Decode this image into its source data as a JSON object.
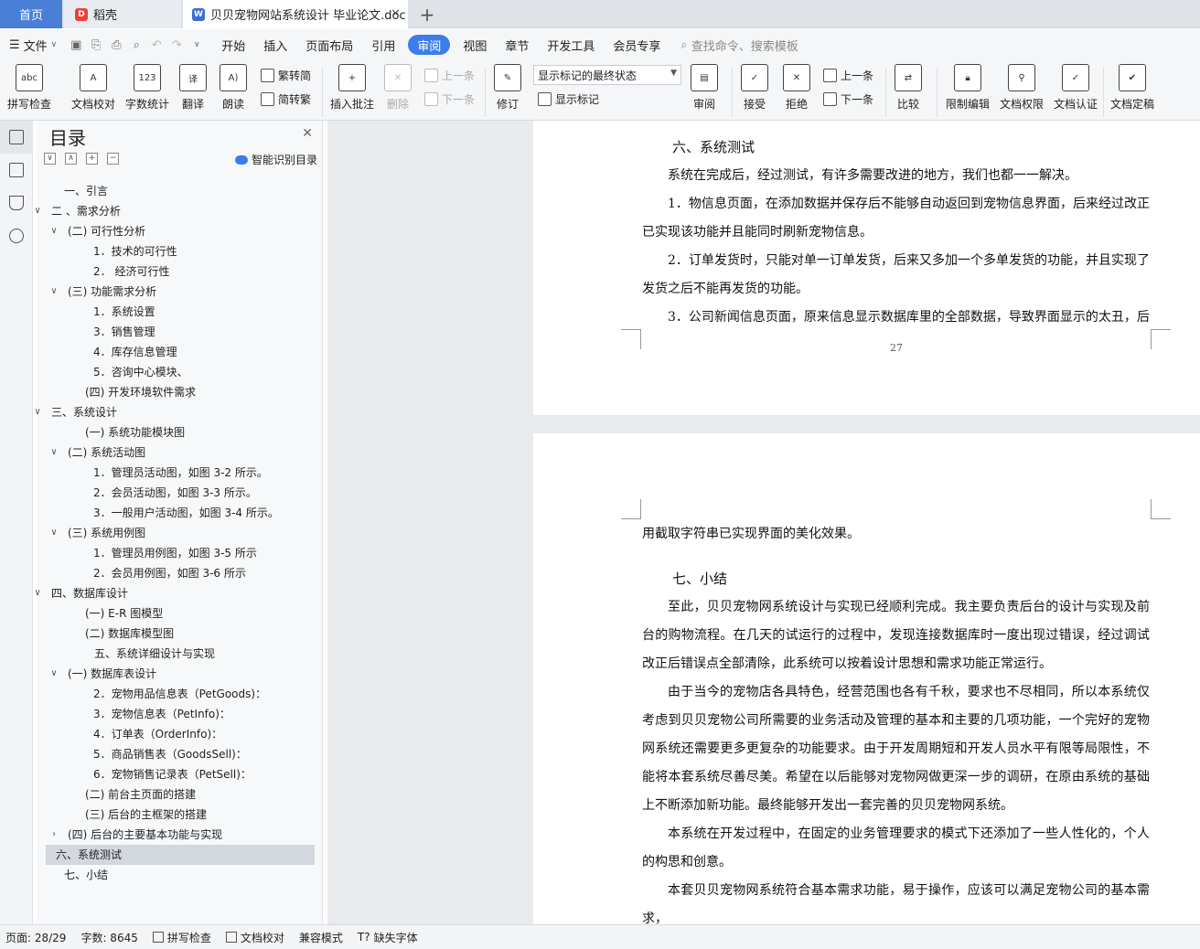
{
  "tabs": {
    "home": "首页",
    "daoke": "稻壳",
    "doc": "贝贝宠物网站系统设计 毕业论文.doc"
  },
  "menu": {
    "file": "文件",
    "items": [
      "开始",
      "插入",
      "页面布局",
      "引用",
      "审阅",
      "视图",
      "章节",
      "开发工具",
      "会员专享"
    ],
    "active": "审阅",
    "search": "查找命令、搜索模板"
  },
  "ribbon": {
    "spell": "拼写检查",
    "proof": "文档校对",
    "count": "字数统计",
    "translate": "翻译",
    "read": "朗读",
    "trad": "繁转简",
    "simp": "简转繁",
    "insert_comment": "插入批注",
    "delete": "删除",
    "prev": "上一条",
    "next": "下一条",
    "revise": "修订",
    "markup_select": "显示标记的最终状态",
    "show_markup": "显示标记",
    "review": "审阅",
    "accept": "接受",
    "reject": "拒绝",
    "prev2": "上一条",
    "next2": "下一条",
    "compare": "比较",
    "restrict": "限制编辑",
    "permission": "文档权限",
    "certify": "文档认证",
    "finalize": "文档定稿"
  },
  "toc": {
    "title": "目录",
    "smart": "智能识别目录",
    "items": [
      {
        "text": "一、引言"
      },
      {
        "text": "二 、需求分析"
      },
      {
        "text": "(二) 可行性分析"
      },
      {
        "text": "1．技术的可行性"
      },
      {
        "text": "2．  经济可行性"
      },
      {
        "text": "(三) 功能需求分析"
      },
      {
        "text": "1．系统设置"
      },
      {
        "text": "3．销售管理"
      },
      {
        "text": "4．库存信息管理"
      },
      {
        "text": "5．咨询中心模块、"
      },
      {
        "text": "(四) 开发环境软件需求"
      },
      {
        "text": "三、系统设计"
      },
      {
        "text": "(一) 系统功能模块图"
      },
      {
        "text": "(二) 系统活动图"
      },
      {
        "text": "1．管理员活动图，如图 3-2 所示。"
      },
      {
        "text": "2．会员活动图，如图 3-3 所示。"
      },
      {
        "text": "3．一般用户活动图，如图 3-4 所示。"
      },
      {
        "text": "(三) 系统用例图"
      },
      {
        "text": "1．管理员用例图，如图 3-5 所示"
      },
      {
        "text": "2．会员用例图，如图 3-6 所示"
      },
      {
        "text": "四、数据库设计"
      },
      {
        "text": "(一) E-R 图模型"
      },
      {
        "text": "(二) 数据库模型图"
      },
      {
        "text": "五、系统详细设计与实现"
      },
      {
        "text": "(一) 数据库表设计"
      },
      {
        "text": "2．宠物用品信息表（PetGoods)："
      },
      {
        "text": "3．宠物信息表（PetInfo)："
      },
      {
        "text": "4．订单表（OrderInfo)："
      },
      {
        "text": "5．商品销售表（GoodsSell)："
      },
      {
        "text": "6．宠物销售记录表（PetSell)："
      },
      {
        "text": "(二) 前台主页面的搭建"
      },
      {
        "text": "(三) 后台的主框架的搭建"
      },
      {
        "text": "(四) 后台的主要基本功能与实现"
      },
      {
        "text": "六、系统测试"
      },
      {
        "text": "七、小结"
      }
    ]
  },
  "page1": {
    "heading": "六、系统测试",
    "paras": [
      "系统在完成后，经过测试，有许多需要改进的地方，我们也都一一解决。",
      "1．物信息页面，在添加数据并保存后不能够自动返回到宠物信息界面，后来经过改正已实现该功能并且能同时刷新宠物信息。",
      "2．订单发货时，只能对单一订单发货，后来又多加一个多单发货的功能，并且实现了发货之后不能再发货的功能。",
      "3．公司新闻信息页面，原来信息显示数据库里的全部数据，导致界面显示的太丑，后"
    ],
    "page_number": "27"
  },
  "page2": {
    "continued": "用截取字符串已实现界面的美化效果。",
    "heading": "七、小结",
    "paras": [
      "至此，贝贝宠物网系统设计与实现已经顺利完成。我主要负责后台的设计与实现及前台的购物流程。在几天的试运行的过程中，发现连接数据库时一度出现过错误，经过调试改正后错误点全部清除，此系统可以按着设计思想和需求功能正常运行。",
      "由于当今的宠物店各具特色，经营范围也各有千秋，要求也不尽相同，所以本系统仅考虑到贝贝宠物公司所需要的业务活动及管理的基本和主要的几项功能，一个完好的宠物网系统还需要更多更复杂的功能要求。由于开发周期短和开发人员水平有限等局限性，不能将本套系统尽善尽美。希望在以后能够对宠物网做更深一步的调研，在原由系统的基础上不断添加新功能。最终能够开发出一套完善的贝贝宠物网系统。",
      "本系统在开发过程中，在固定的业务管理要求的模式下还添加了一些人性化的，个人的构思和创意。",
      "本套贝贝宠物网系统符合基本需求功能，易于操作，应该可以满足宠物公司的基本需求，"
    ]
  },
  "status": {
    "page": "页面: 28/29",
    "words": "字数: 8645",
    "spell": "拼写检查",
    "proof": "文档校对",
    "compat": "兼容模式",
    "font": "缺失字体"
  },
  "colors": {
    "accent": "#3b7de9",
    "home_tab": "#4a7fd6",
    "selection": "#d3d7de"
  }
}
